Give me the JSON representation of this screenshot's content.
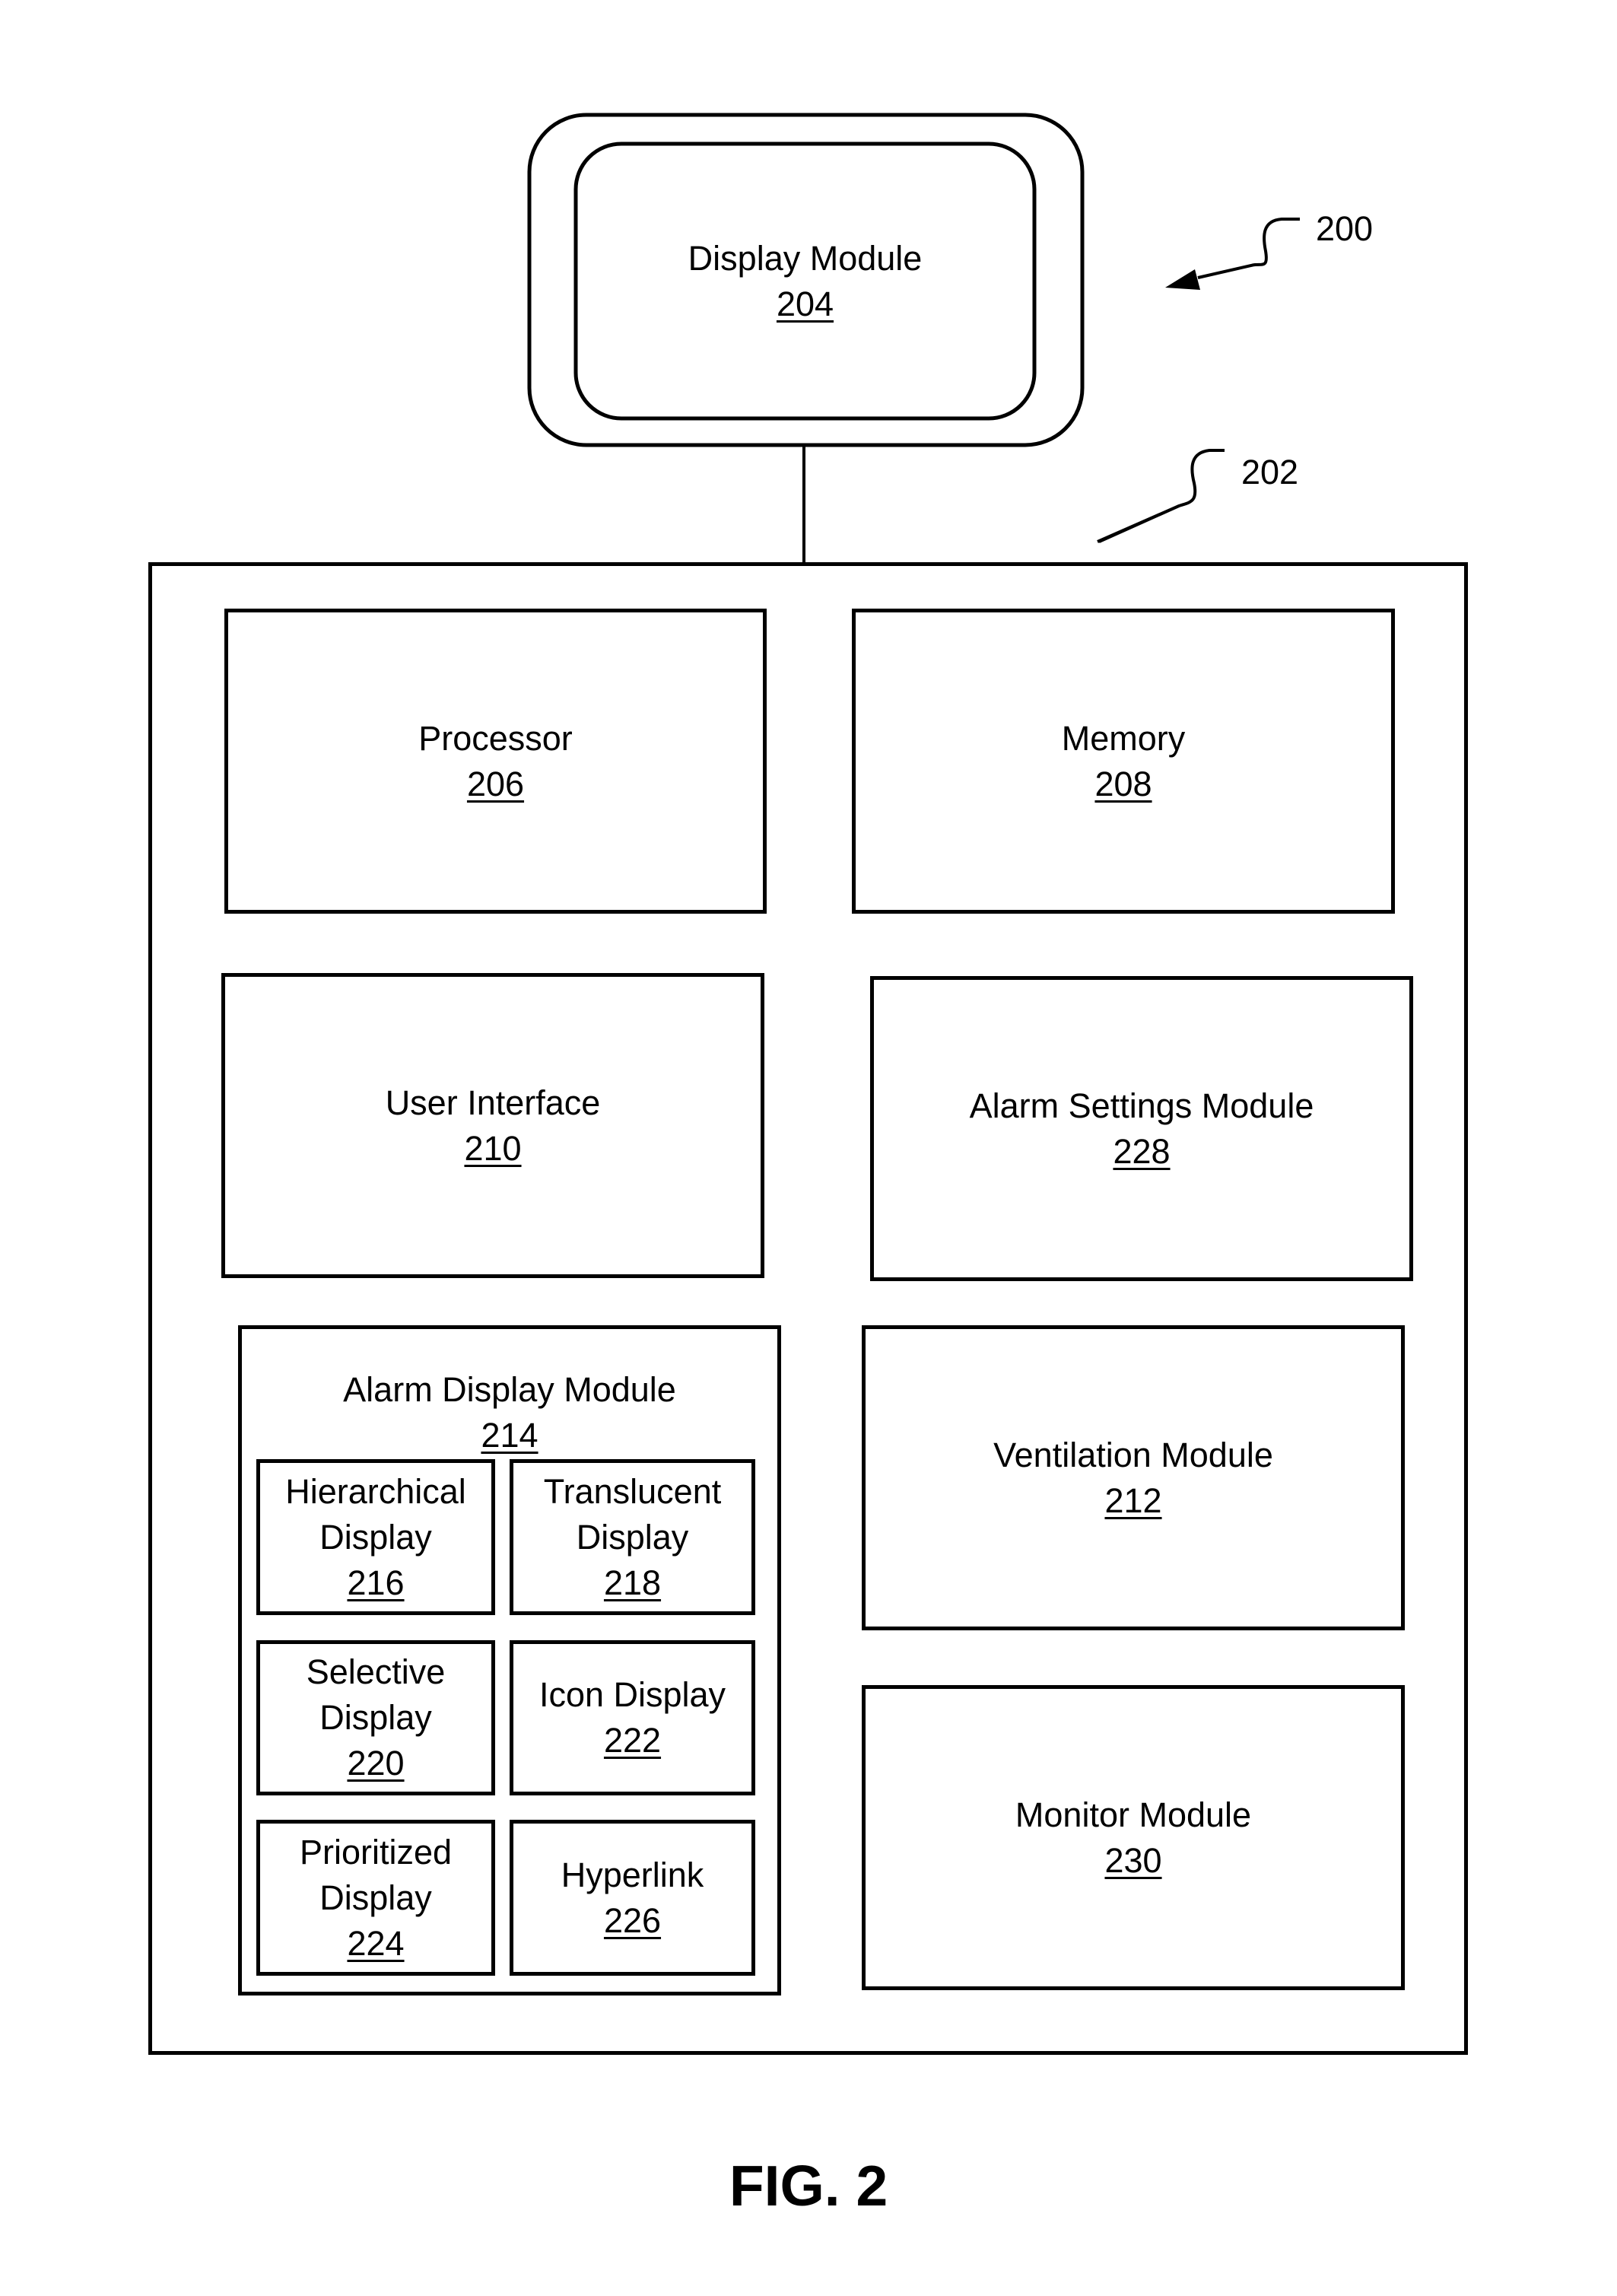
{
  "figure": {
    "caption": "FIG. 2",
    "system_ref": "200",
    "device_ref": "202"
  },
  "display_module": {
    "label": "Display Module",
    "ref": "204"
  },
  "components": {
    "processor": {
      "label": "Processor",
      "ref": "206"
    },
    "memory": {
      "label": "Memory",
      "ref": "208"
    },
    "user_interface": {
      "label": "User Interface",
      "ref": "210"
    },
    "alarm_settings": {
      "label": "Alarm Settings Module",
      "ref": "228"
    },
    "ventilation": {
      "label": "Ventilation Module",
      "ref": "212"
    },
    "monitor": {
      "label": "Monitor Module",
      "ref": "230"
    }
  },
  "alarm_display_module": {
    "label": "Alarm Display Module",
    "ref": "214",
    "submodules": [
      {
        "line1": "Hierarchical",
        "line2": "Display",
        "ref": "216"
      },
      {
        "line1": "Translucent",
        "line2": "Display",
        "ref": "218"
      },
      {
        "line1": "Selective",
        "line2": "Display",
        "ref": "220"
      },
      {
        "line1": "Icon Display",
        "line2": "",
        "ref": "222"
      },
      {
        "line1": "Prioritized",
        "line2": "Display",
        "ref": "224"
      },
      {
        "line1": "Hyperlink",
        "line2": "",
        "ref": "226"
      }
    ]
  }
}
